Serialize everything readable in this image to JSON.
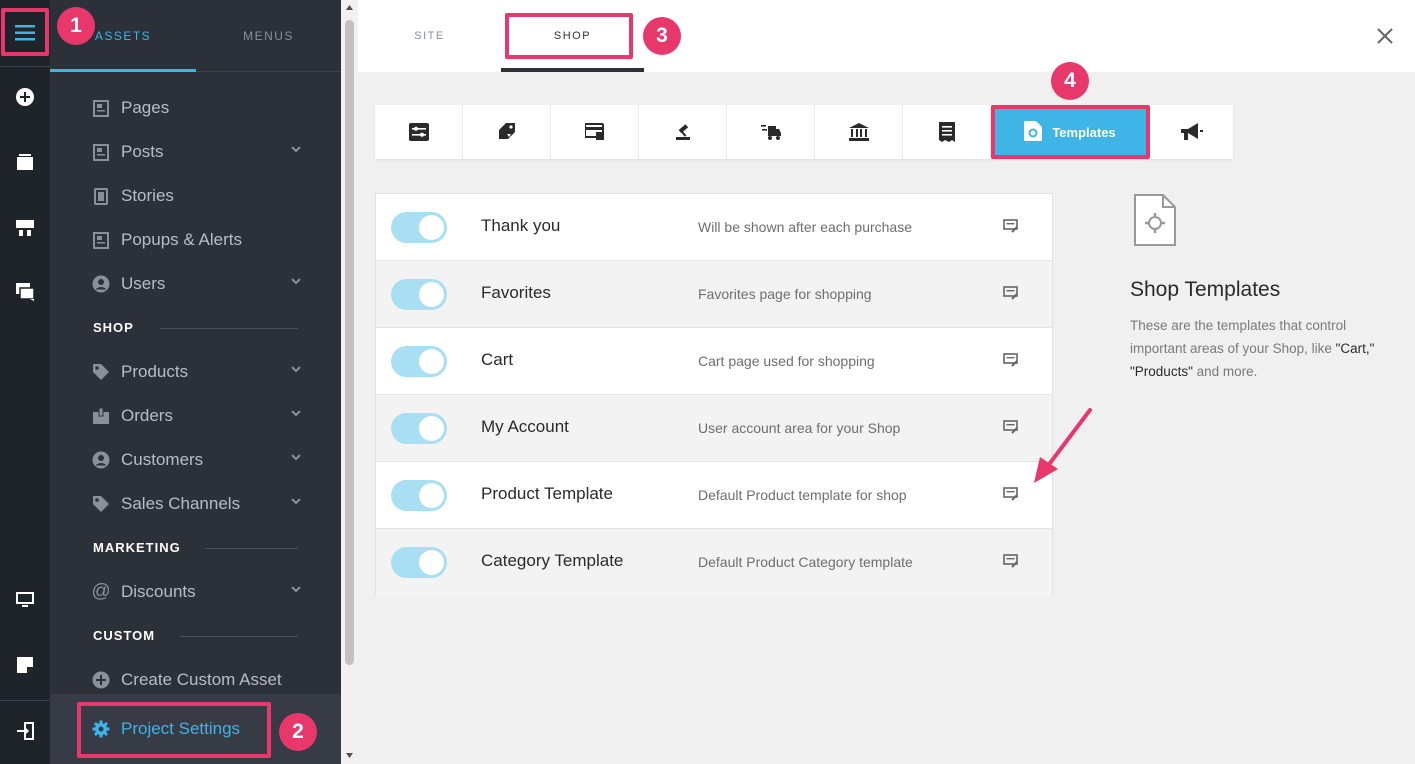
{
  "sidebar": {
    "tabs": [
      "ASSETS",
      "MENUS"
    ],
    "items": [
      {
        "label": "Pages",
        "chevron": false
      },
      {
        "label": "Posts",
        "chevron": true
      },
      {
        "label": "Stories",
        "chevron": false
      },
      {
        "label": "Popups & Alerts",
        "chevron": false
      },
      {
        "label": "Users",
        "chevron": true
      }
    ],
    "sections": {
      "shop": "SHOP",
      "marketing": "MARKETING",
      "custom": "CUSTOM"
    },
    "shop_items": [
      {
        "label": "Products"
      },
      {
        "label": "Orders"
      },
      {
        "label": "Customers"
      },
      {
        "label": "Sales Channels"
      }
    ],
    "marketing_items": [
      {
        "label": "Discounts"
      }
    ],
    "custom_items": [
      {
        "label": "Create Custom Asset"
      }
    ],
    "project_settings": "Project Settings"
  },
  "main": {
    "tabs": [
      "SITE",
      "SHOP"
    ],
    "templates_label": "Templates",
    "rows": [
      {
        "title": "Thank you",
        "desc": "Will be shown after each purchase",
        "enabled": true
      },
      {
        "title": "Favorites",
        "desc": "Favorites page for shopping",
        "enabled": true
      },
      {
        "title": "Cart",
        "desc": "Cart page used for shopping",
        "enabled": true
      },
      {
        "title": "My Account",
        "desc": "User account area for your Shop",
        "enabled": true
      },
      {
        "title": "Product Template",
        "desc": "Default Product template for shop",
        "enabled": true
      },
      {
        "title": "Category Template",
        "desc": "Default Product Category template",
        "enabled": true
      }
    ],
    "info": {
      "title": "Shop Templates",
      "desc_1": "These are the templates that control important areas of your Shop, like ",
      "desc_cart": "\"Cart,\"",
      "desc_products": "\"Products\"",
      "desc_2": " and more."
    }
  },
  "annotations": {
    "badges": [
      "1",
      "2",
      "3",
      "4"
    ],
    "accent": "#e8386b"
  },
  "colors": {
    "accent_blue": "#3fb4e6",
    "sidebar_bg": "#2c3039",
    "rail_bg": "#1f232a"
  }
}
